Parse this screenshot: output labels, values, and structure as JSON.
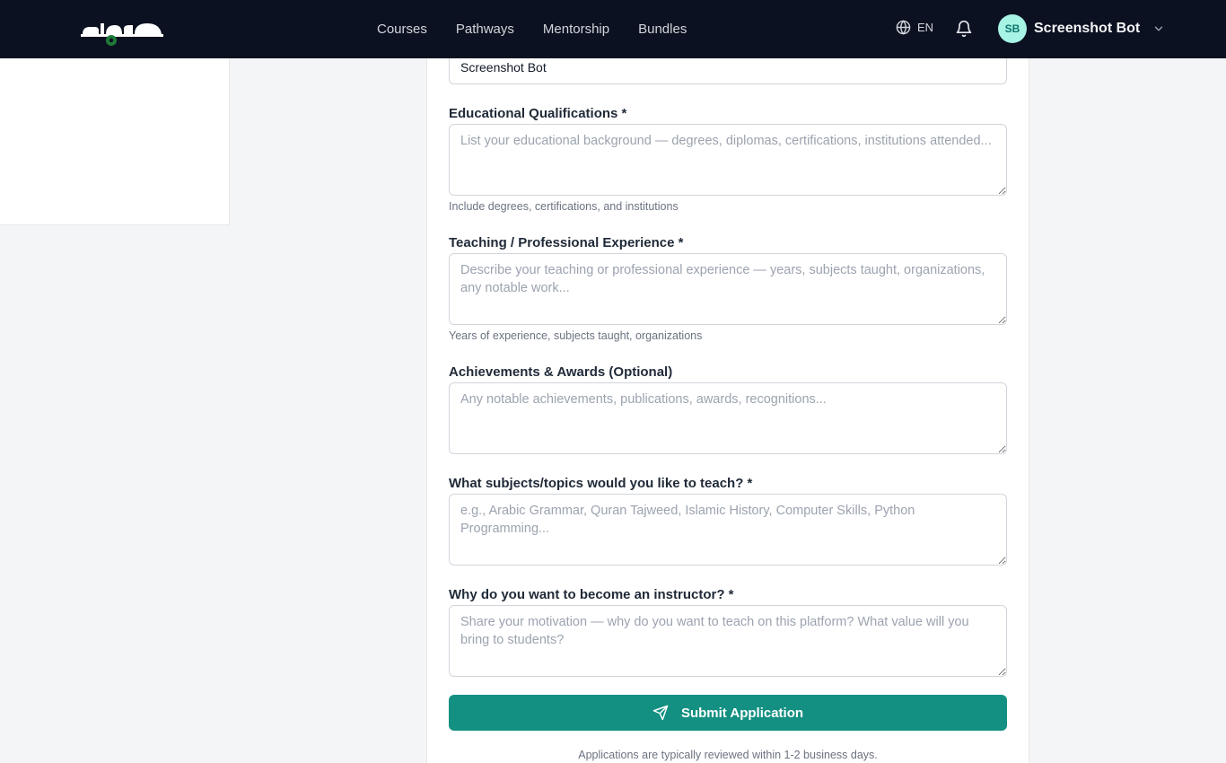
{
  "header": {
    "nav": [
      "Courses",
      "Pathways",
      "Mentorship",
      "Bundles"
    ],
    "language": "EN",
    "user": {
      "initials": "SB",
      "name": "Screenshot Bot"
    }
  },
  "form": {
    "name_value": "Screenshot Bot",
    "education": {
      "label": "Educational Qualifications *",
      "placeholder": "List your educational background — degrees, diplomas, certifications, institutions attended...",
      "hint": "Include degrees, certifications, and institutions"
    },
    "experience": {
      "label": "Teaching / Professional Experience *",
      "placeholder": "Describe your teaching or professional experience — years, subjects taught, organizations, any notable work...",
      "hint": "Years of experience, subjects taught, organizations"
    },
    "achievements": {
      "label": "Achievements & Awards (Optional)",
      "placeholder": "Any notable achievements, publications, awards, recognitions..."
    },
    "subjects": {
      "label": "What subjects/topics would you like to teach? *",
      "placeholder": "e.g., Arabic Grammar, Quran Tajweed, Islamic History, Computer Skills, Python Programming..."
    },
    "motivation": {
      "label": "Why do you want to become an instructor? *",
      "placeholder": "Share your motivation — why do you want to teach on this platform? What value will you bring to students?"
    },
    "submit_label": "Submit Application",
    "footnote": "Applications are typically reviewed within 1-2 business days."
  },
  "colors": {
    "topbar": "#0b1120",
    "accent": "#139082",
    "logo_green": "#1f7a3a"
  },
  "icons": {
    "language": "globe-icon",
    "notifications": "bell-icon",
    "menu": "chevron-down-icon",
    "submit": "send-icon"
  }
}
